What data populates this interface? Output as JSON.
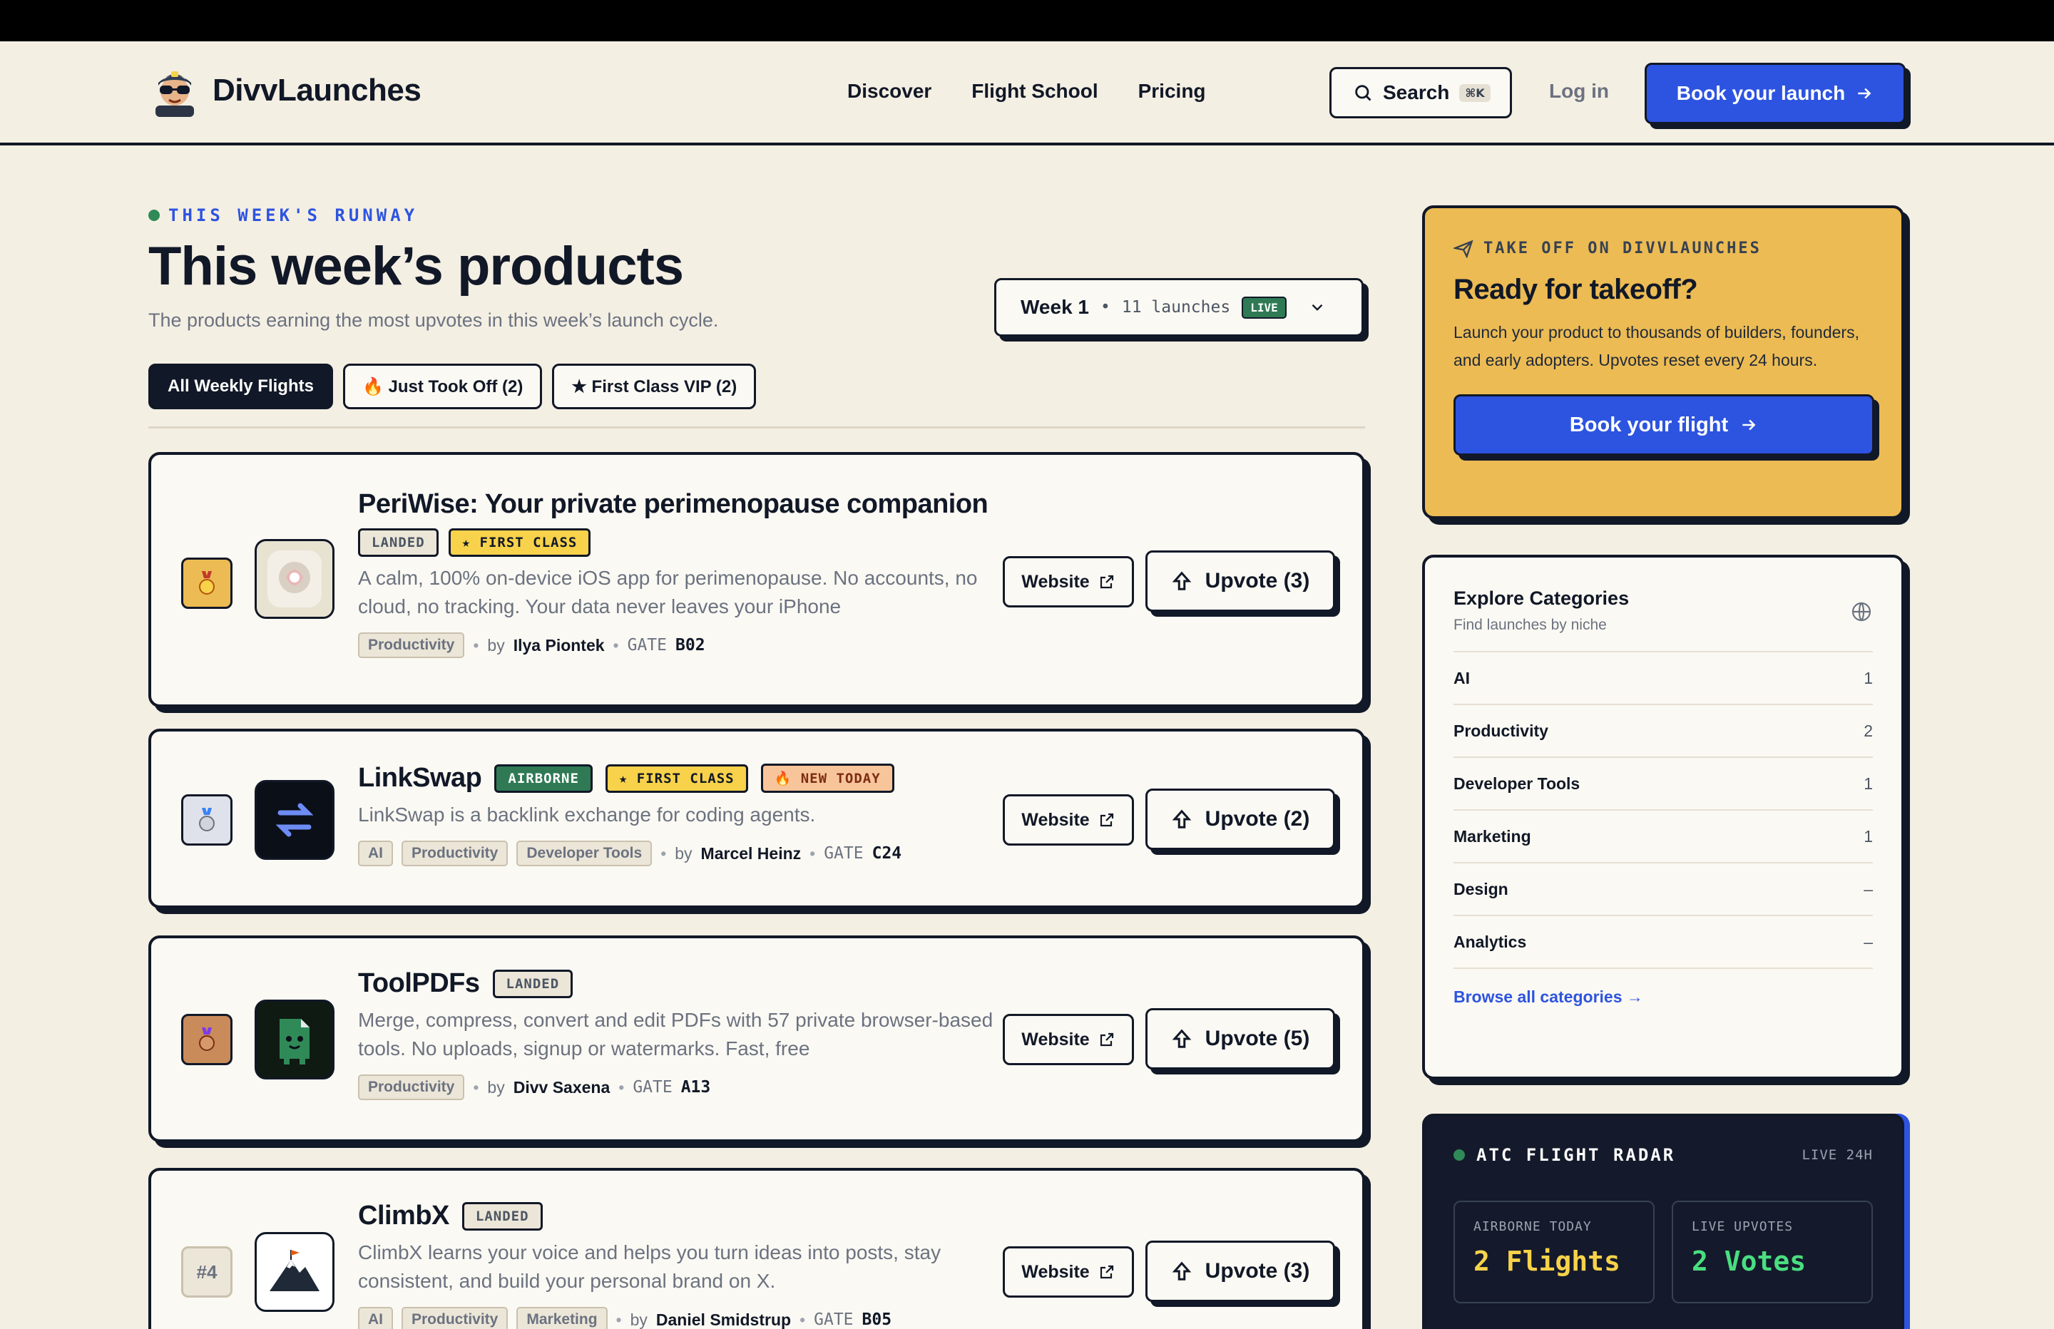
{
  "header": {
    "brand": "DivvLaunches",
    "nav": [
      "Discover",
      "Flight School",
      "Pricing"
    ],
    "search_label": "Search",
    "search_kbd": "⌘K",
    "login_label": "Log in",
    "book_label": "Book your launch"
  },
  "hero": {
    "eyebrow": "THIS WEEK'S RUNWAY",
    "title": "This week’s products",
    "subtitle": "The products earning the most upvotes in this week’s launch cycle.",
    "week_label": "Week 1",
    "week_count": "11 launches",
    "week_live": "LIVE"
  },
  "filters": [
    "All Weekly Flights",
    "🔥 Just Took Off (2)",
    "★ First Class VIP (2)"
  ],
  "products": [
    {
      "rank": "",
      "title": "PeriWise: Your private perimenopause companion",
      "badges": [
        {
          "text": "LANDED",
          "kind": "landed"
        },
        {
          "text": "★ FIRST CLASS",
          "kind": "first"
        }
      ],
      "description": "A calm, 100% on-device iOS app for perimenopause. No accounts, no cloud, no tracking. Your data never leaves your iPhone",
      "tags": [
        "Productivity"
      ],
      "by": "by",
      "maker": "Ilya Piontek",
      "gate_label": "GATE",
      "gate": "B02",
      "website": "Website",
      "upvote": "Upvote (3)"
    },
    {
      "rank": "",
      "title": "LinkSwap",
      "badges": [
        {
          "text": "AIRBORNE",
          "kind": "air"
        },
        {
          "text": "★ FIRST CLASS",
          "kind": "first"
        },
        {
          "text": "🔥 NEW TODAY",
          "kind": "new"
        }
      ],
      "description": "LinkSwap is a backlink exchange for coding agents.",
      "tags": [
        "AI",
        "Productivity",
        "Developer Tools"
      ],
      "by": "by",
      "maker": "Marcel Heinz",
      "gate_label": "GATE",
      "gate": "C24",
      "website": "Website",
      "upvote": "Upvote (2)"
    },
    {
      "rank": "",
      "title": "ToolPDFs",
      "badges": [
        {
          "text": "LANDED",
          "kind": "landed"
        }
      ],
      "description": "Merge, compress, convert and edit PDFs with 57 private browser-based tools. No uploads, signup or watermarks. Fast, free",
      "tags": [
        "Productivity"
      ],
      "by": "by",
      "maker": "Divv Saxena",
      "gate_label": "GATE",
      "gate": "A13",
      "website": "Website",
      "upvote": "Upvote (5)"
    },
    {
      "rank": "#4",
      "title": "ClimbX",
      "badges": [
        {
          "text": "LANDED",
          "kind": "landed"
        }
      ],
      "description": "ClimbX learns your voice and helps you turn ideas into posts, stay consistent, and build your personal brand on X.",
      "tags": [
        "AI",
        "Productivity",
        "Marketing"
      ],
      "by": "by",
      "maker": "Daniel Smidstrup",
      "gate_label": "GATE",
      "gate": "B05",
      "website": "Website",
      "upvote": "Upvote (3)"
    }
  ],
  "cta": {
    "eyebrow": "TAKE OFF ON DIVVLAUNCHES",
    "title": "Ready for takeoff?",
    "body": "Launch your product to thousands of builders, founders, and early adopters. Upvotes reset every 24 hours.",
    "button": "Book your flight"
  },
  "categories": {
    "title": "Explore Categories",
    "subtitle": "Find launches by niche",
    "items": [
      {
        "name": "AI",
        "count": "1"
      },
      {
        "name": "Productivity",
        "count": "2"
      },
      {
        "name": "Developer Tools",
        "count": "1"
      },
      {
        "name": "Marketing",
        "count": "1"
      },
      {
        "name": "Design",
        "count": "–"
      },
      {
        "name": "Analytics",
        "count": "–"
      }
    ],
    "browse": "Browse all categories"
  },
  "radar": {
    "title": "ATC FLIGHT RADAR",
    "live": "LIVE 24H",
    "stats": [
      {
        "label": "AIRBORNE TODAY",
        "value": "2 Flights",
        "color": "#f7d24a"
      },
      {
        "label": "LIVE UPVOTES",
        "value": "2 Votes",
        "color": "#4ade80"
      }
    ]
  },
  "colors": {
    "accent": "#2d54e0",
    "cta_bg": "#ecbb54",
    "airborne": "#2f7a55",
    "gold": "#f7d24a",
    "page_bg": "#f4efe3"
  }
}
